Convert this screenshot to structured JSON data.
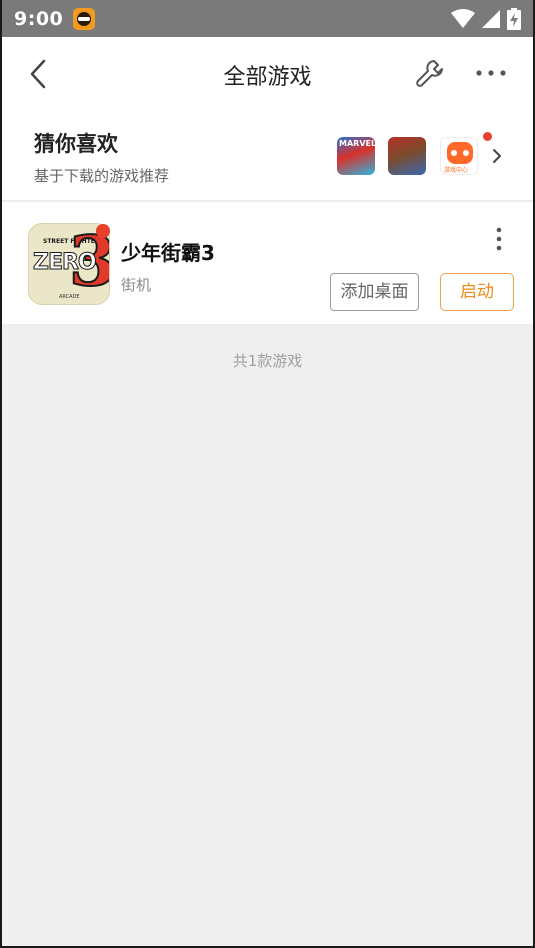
{
  "status_bar": {
    "time": "9:00",
    "app_icon": "game-center-icon",
    "wifi_icon": "wifi-icon",
    "signal_icon": "signal-icon",
    "battery_icon": "battery-charging-icon"
  },
  "header": {
    "title": "全部游戏",
    "back_icon": "back-arrow-icon",
    "tool_icon": "wrench-icon",
    "more_icon": "more-horizontal-icon"
  },
  "recommend": {
    "title": "猜你喜欢",
    "subtitle": "基于下载的游戏推荐",
    "thumbnails": [
      {
        "text": "MARVEL",
        "icon": "marvel-game-thumb"
      },
      {
        "text": "",
        "icon": "fighter-game-thumb"
      },
      {
        "text": "游戏中心",
        "icon": "game-center-thumb"
      }
    ],
    "chevron_icon": "chevron-right-icon"
  },
  "game": {
    "name": "少年街霸3",
    "category": "街机",
    "icon_text": "ZERO",
    "icon_number": "3",
    "icon_small_text": "STREET FIGHTER",
    "icon_footer": "ARCADE",
    "add_desktop_label": "添加桌面",
    "launch_label": "启动",
    "accent_color": "#f08a1a"
  },
  "footer": {
    "count_text": "共1款游戏"
  }
}
